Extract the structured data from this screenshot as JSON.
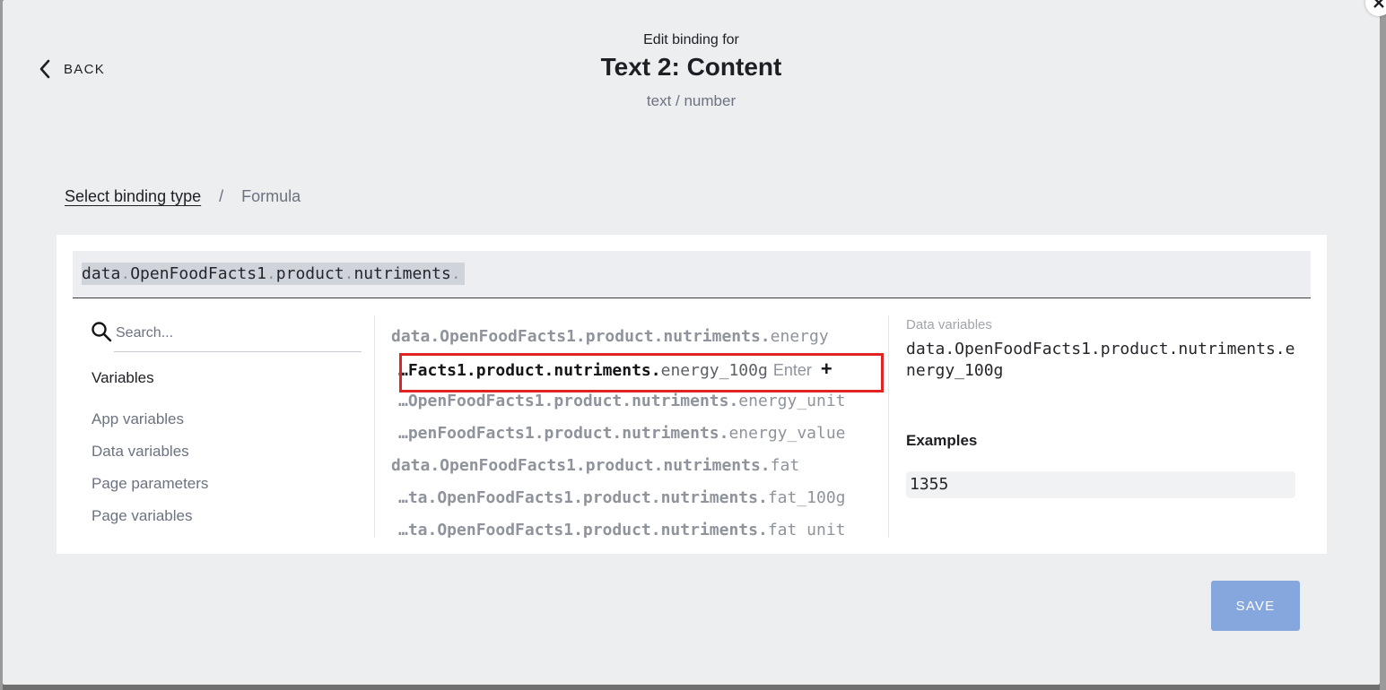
{
  "modal": {
    "back_label": "BACK",
    "pretitle": "Edit binding for",
    "title": "Text 2: Content",
    "type_label": "text / number"
  },
  "breadcrumb": {
    "link": "Select binding type",
    "separator": "/",
    "current": "Formula"
  },
  "formula": {
    "tokens": [
      "data",
      ".",
      "OpenFoodFacts1",
      ".",
      "product",
      ".",
      "nutriments",
      "."
    ]
  },
  "search": {
    "placeholder": "Search..."
  },
  "variables": {
    "heading": "Variables",
    "categories": [
      "App variables",
      "Data variables",
      "Page parameters",
      "Page variables"
    ]
  },
  "suggestions": [
    {
      "prefix": "data.OpenFoodFacts1.product.nutriments.",
      "name": "energy"
    },
    {
      "prefix": "…Facts1.product.nutriments.",
      "name": "energy_100g",
      "enter": "Enter",
      "plus": "+"
    },
    {
      "prefix": "…OpenFoodFacts1.product.nutriments.",
      "name": "energy_unit"
    },
    {
      "prefix": "…penFoodFacts1.product.nutriments.",
      "name": "energy_value"
    },
    {
      "prefix": "data.OpenFoodFacts1.product.nutriments.",
      "name": "fat"
    },
    {
      "prefix": "…ta.OpenFoodFacts1.product.nutriments.",
      "name": "fat_100g"
    },
    {
      "prefix": "…ta.OpenFoodFacts1.product.nutriments.",
      "name": "fat_unit"
    }
  ],
  "details": {
    "label": "Data variables",
    "value": "data.OpenFoodFacts1.product.nutriments.energy_100g",
    "examples_label": "Examples",
    "example_value": "1355"
  },
  "actions": {
    "save_label": "SAVE"
  },
  "colors": {
    "accent": "#85a7dd",
    "highlight_border": "#e02424"
  }
}
